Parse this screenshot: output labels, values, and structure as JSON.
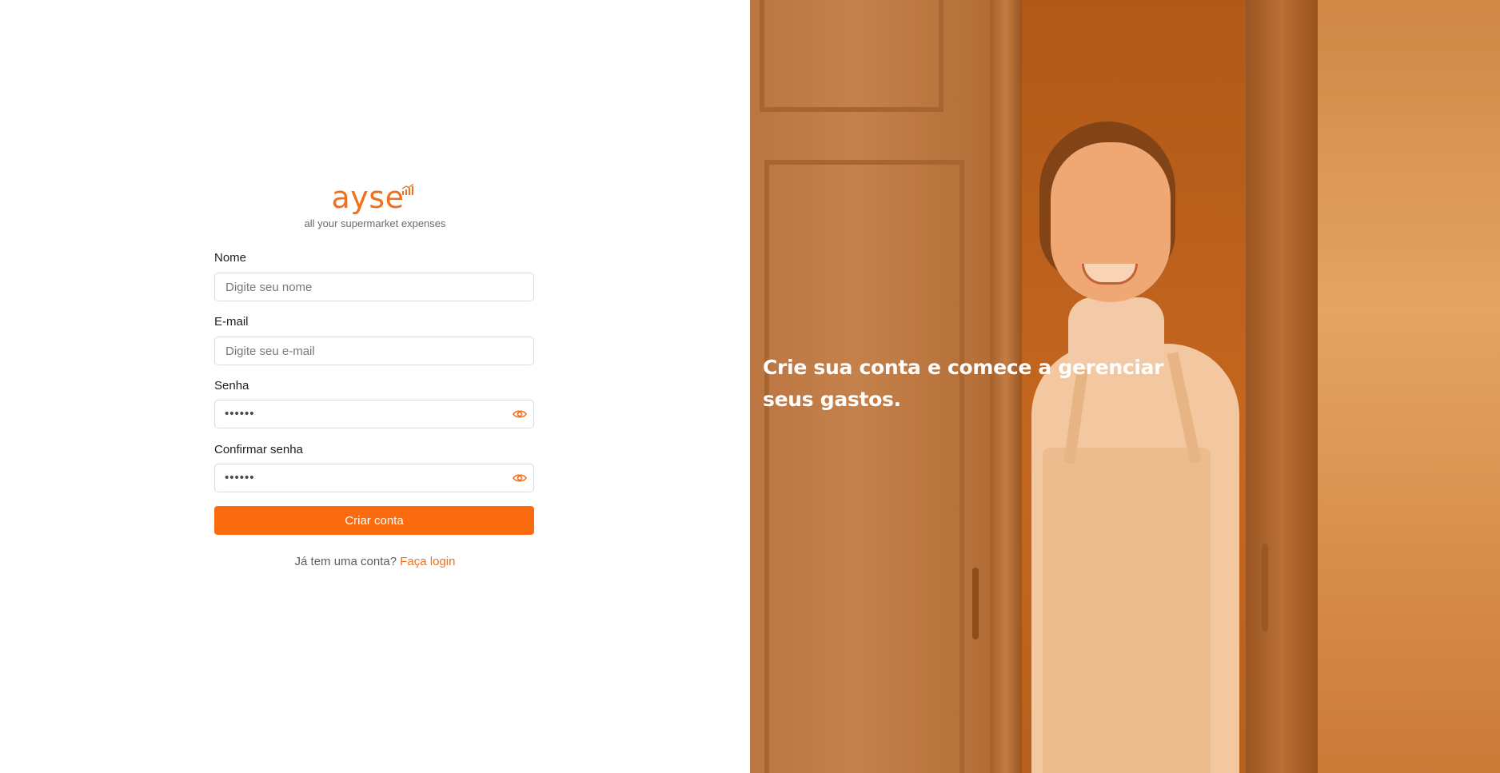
{
  "brand": {
    "name": "ayse",
    "tagline": "all your supermarket expenses",
    "accent_color": "#f26f1b",
    "button_color": "#fa6b0f",
    "logo_icon": "bar-chart-icon"
  },
  "form": {
    "name": {
      "label": "Nome",
      "placeholder": "Digite seu nome",
      "value": ""
    },
    "email": {
      "label": "E-mail",
      "placeholder": "Digite seu e-mail",
      "value": ""
    },
    "password": {
      "label": "Senha",
      "masked_value": "••••••",
      "icon": "eye-icon"
    },
    "confirm_password": {
      "label": "Confirmar senha",
      "masked_value": "••••••",
      "icon": "eye-icon"
    },
    "submit_label": "Criar conta"
  },
  "login_prompt": {
    "text": "Já tem uma conta?",
    "link_label": "Faça login"
  },
  "hero": {
    "text": "Crie sua conta e comece a gerenciar seus gastos.",
    "overlay_color": "#e88228"
  }
}
